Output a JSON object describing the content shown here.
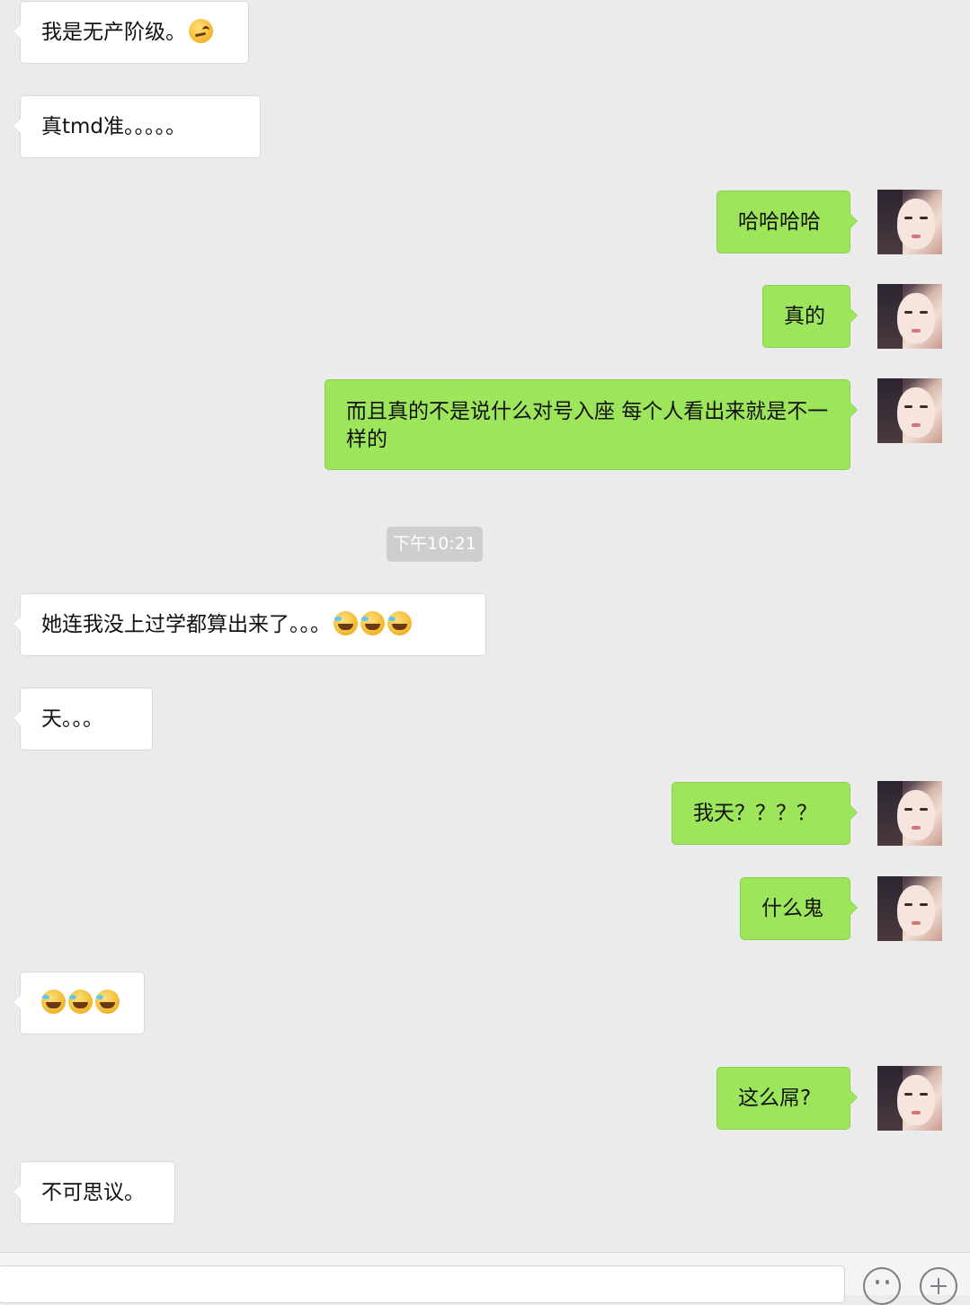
{
  "messages": [
    {
      "side": "left",
      "text": "我是无产阶级。",
      "emoji": [
        "smirk"
      ]
    },
    {
      "side": "left",
      "text": "真tmd准。。。。。"
    },
    {
      "side": "right",
      "text": "哈哈哈哈"
    },
    {
      "side": "right",
      "text": "真的"
    },
    {
      "side": "right",
      "text": "而且真的不是说什么对号入座 每个人看出来就是不一样的"
    },
    {
      "side": "left",
      "text": "她连我没上过学都算出来了。。。",
      "emoji": [
        "lol",
        "lol",
        "lol"
      ]
    },
    {
      "side": "left",
      "text": "天。。。"
    },
    {
      "side": "right",
      "text": "我天？？？？"
    },
    {
      "side": "right",
      "text": "什么鬼"
    },
    {
      "side": "left",
      "text": "",
      "emoji": [
        "lol",
        "lol",
        "lol"
      ]
    },
    {
      "side": "right",
      "text": "这么屌?"
    },
    {
      "side": "left",
      "text": "不可思议。"
    }
  ],
  "timestamp": "下午10:21",
  "input": {
    "value": "",
    "placeholder": ""
  },
  "icons": {
    "emoji_button": "smiley-icon",
    "more_button": "plus-icon"
  },
  "colors": {
    "background": "#ebebeb",
    "sent_bubble": "#9de65c",
    "received_bubble": "#ffffff"
  }
}
